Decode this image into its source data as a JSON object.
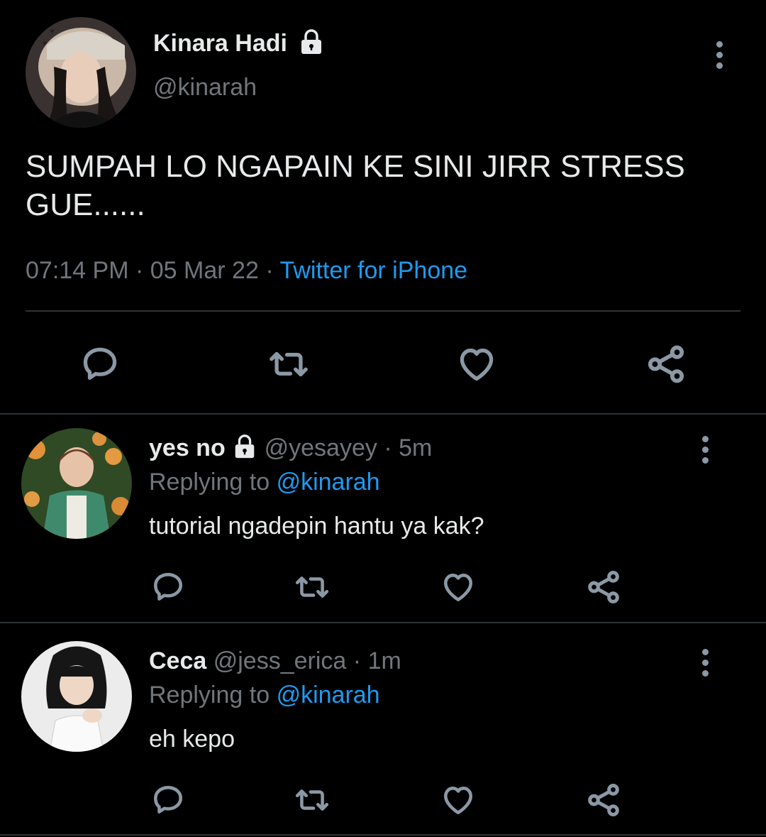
{
  "main_tweet": {
    "name": "Kinara Hadi",
    "handle": "@kinarah",
    "text": "SUMPAH LO NGAPAIN KE SINI JIRR STRESS GUE......",
    "time": "07:14 PM",
    "date": "05 Mar 22",
    "source": "Twitter for iPhone",
    "separator": "·"
  },
  "replies": [
    {
      "name": "yes no",
      "locked": true,
      "handle": "@yesayey",
      "age": "5m",
      "replying_prefix": "Replying to",
      "replying_handle": "@kinarah",
      "text": "tutorial ngadepin hantu ya kak?"
    },
    {
      "name": "Ceca",
      "locked": false,
      "handle": "@jess_erica",
      "age": "1m",
      "replying_prefix": "Replying to",
      "replying_handle": "@kinarah",
      "text": "eh kepo"
    }
  ],
  "colors": {
    "background": "#000000",
    "text": "#e7e9ea",
    "secondary": "#71767b",
    "accent": "#1d9bf0",
    "divider": "#2f3336"
  },
  "icons": [
    "lock-icon",
    "more-icon",
    "reply-icon",
    "retweet-icon",
    "like-icon",
    "share-icon"
  ]
}
